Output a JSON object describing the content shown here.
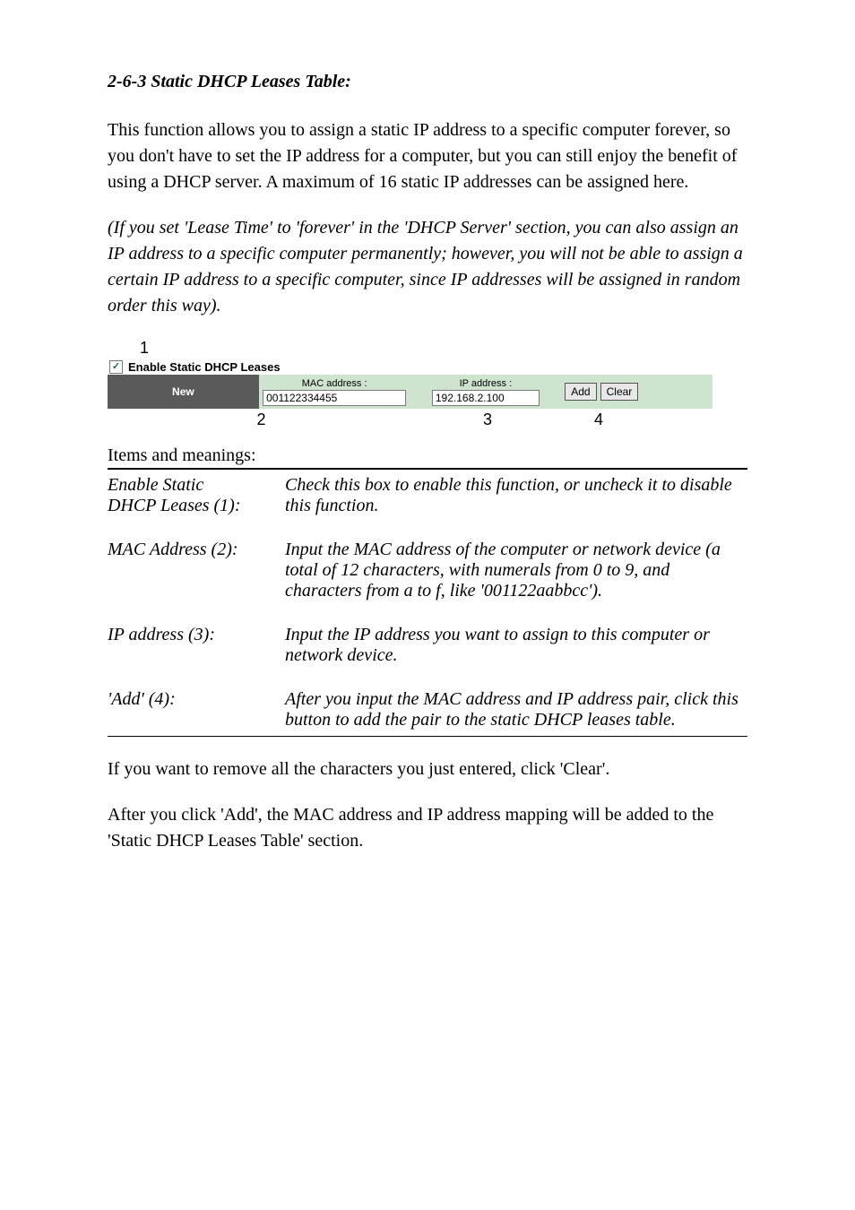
{
  "title": "2-6-3 Static DHCP Leases Table:",
  "para1": "This function allows you to assign a static IP address to a specific computer forever, so you don't have to set the IP address for a computer, but you can still enjoy the benefit of using a DHCP server. A maximum of 16 static IP addresses can be assigned here.",
  "para2": "(If you set 'Lease Time' to 'forever' in the 'DHCP Server' section, you can also assign an IP address to a specific computer permanently; however, you will not be able to assign a certain IP address to a specific computer, since IP addresses will be assigned in random order this way).",
  "ui": {
    "callout1": "1",
    "checkbox_checked_glyph": "✓",
    "enable_label": "Enable Static DHCP Leases",
    "new_badge": "New",
    "mac_label": "MAC address :",
    "ip_label": "IP address :",
    "mac_value": "001122334455",
    "ip_value": "192.168.2.100",
    "add_label": "Add",
    "clear_label": "Clear",
    "callout2": "2",
    "callout3": "3",
    "callout4": "4"
  },
  "defs_heading": "Items and meanings:",
  "defs": [
    {
      "term1": "Enable Static",
      "term2": "DHCP Leases (1):",
      "desc": "Check this box to enable this function, or uncheck it to disable this function."
    },
    {
      "term1": "MAC Address (2):",
      "term2": "",
      "desc": "Input the MAC address of the computer or network device (a total of 12 characters, with numerals from 0 to 9, and characters from a to f, like '001122aabbcc')."
    },
    {
      "term1": "IP address (3):",
      "term2": "",
      "desc": "Input the IP address you want to assign to this computer or network device."
    },
    {
      "term1": "'Add' (4):",
      "term2": "",
      "desc": "After you input the MAC address and IP address pair, click this button to add the pair to the static DHCP leases table."
    }
  ],
  "para3": "If you want to remove all the characters you just entered, click 'Clear'.",
  "para4": "After you click 'Add', the MAC address and IP address mapping will be added to the 'Static DHCP Leases Table' section."
}
